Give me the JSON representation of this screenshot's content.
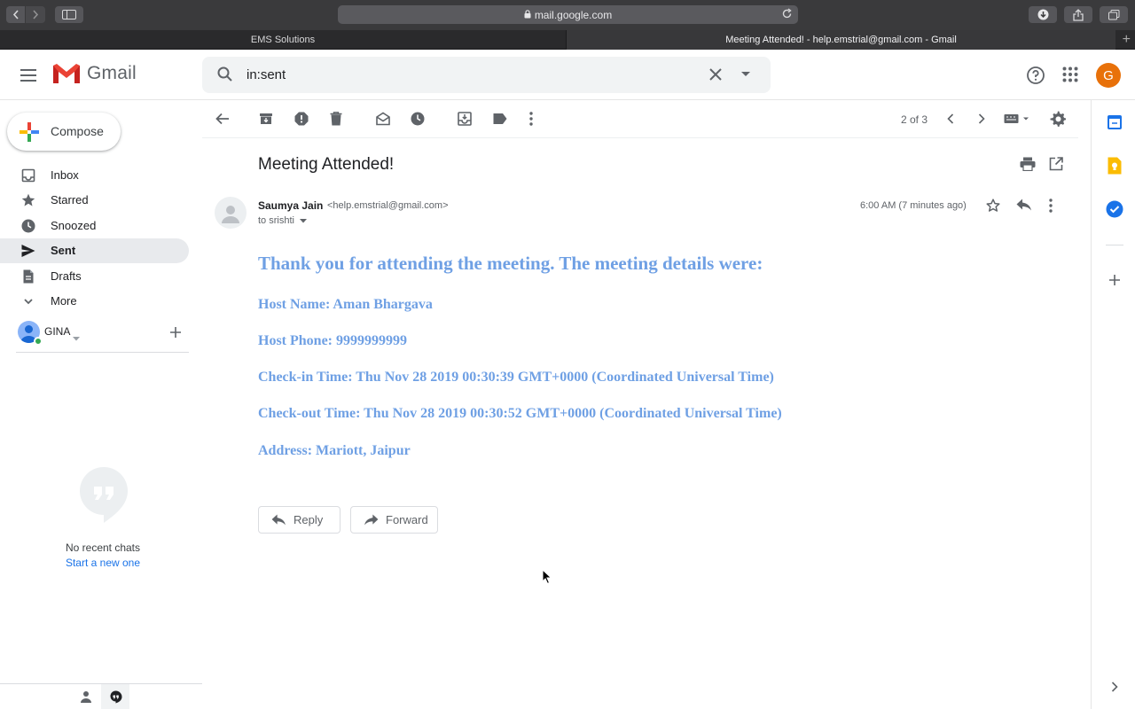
{
  "browser": {
    "url": "mail.google.com",
    "tabs": [
      {
        "label": "EMS Solutions",
        "active": false
      },
      {
        "label": "Meeting Attended! - help.emstrial@gmail.com - Gmail",
        "active": true
      }
    ]
  },
  "header": {
    "logo_text": "Gmail",
    "search_value": "in:sent",
    "avatar_letter": "G",
    "avatar_color": "#e8710a"
  },
  "sidebar": {
    "compose_label": "Compose",
    "items": [
      {
        "label": "Inbox",
        "icon": "inbox-icon",
        "selected": false
      },
      {
        "label": "Starred",
        "icon": "star-icon",
        "selected": false
      },
      {
        "label": "Snoozed",
        "icon": "clock-icon",
        "selected": false
      },
      {
        "label": "Sent",
        "icon": "send-icon",
        "selected": true
      },
      {
        "label": "Drafts",
        "icon": "draft-icon",
        "selected": false
      },
      {
        "label": "More",
        "icon": "chevron-down-icon",
        "selected": false
      }
    ],
    "hangouts_user": "GINA",
    "no_chats_text": "No recent chats",
    "start_chat_text": "Start a new one"
  },
  "toolbar": {
    "pager": "2 of 3"
  },
  "email": {
    "subject": "Meeting Attended!",
    "sender_name": "Saumya Jain",
    "sender_email": "<help.emstrial@gmail.com>",
    "to_line": "to srishti",
    "timestamp": "6:00 AM (7 minutes ago)",
    "body": {
      "heading": "Thank you for attending the meeting. The meeting details were:",
      "lines": [
        "Host Name: Aman Bhargava",
        "Host Phone: 9999999999",
        "Check-in Time: Thu Nov 28 2019 00:30:39 GMT+0000 (Coordinated Universal Time)",
        "Check-out Time: Thu Nov 28 2019 00:30:52 GMT+0000 (Coordinated Universal Time)",
        "Address: Mariott, Jaipur"
      ]
    },
    "reply_label": "Reply",
    "forward_label": "Forward",
    "body_color": "#6fa0e4"
  }
}
